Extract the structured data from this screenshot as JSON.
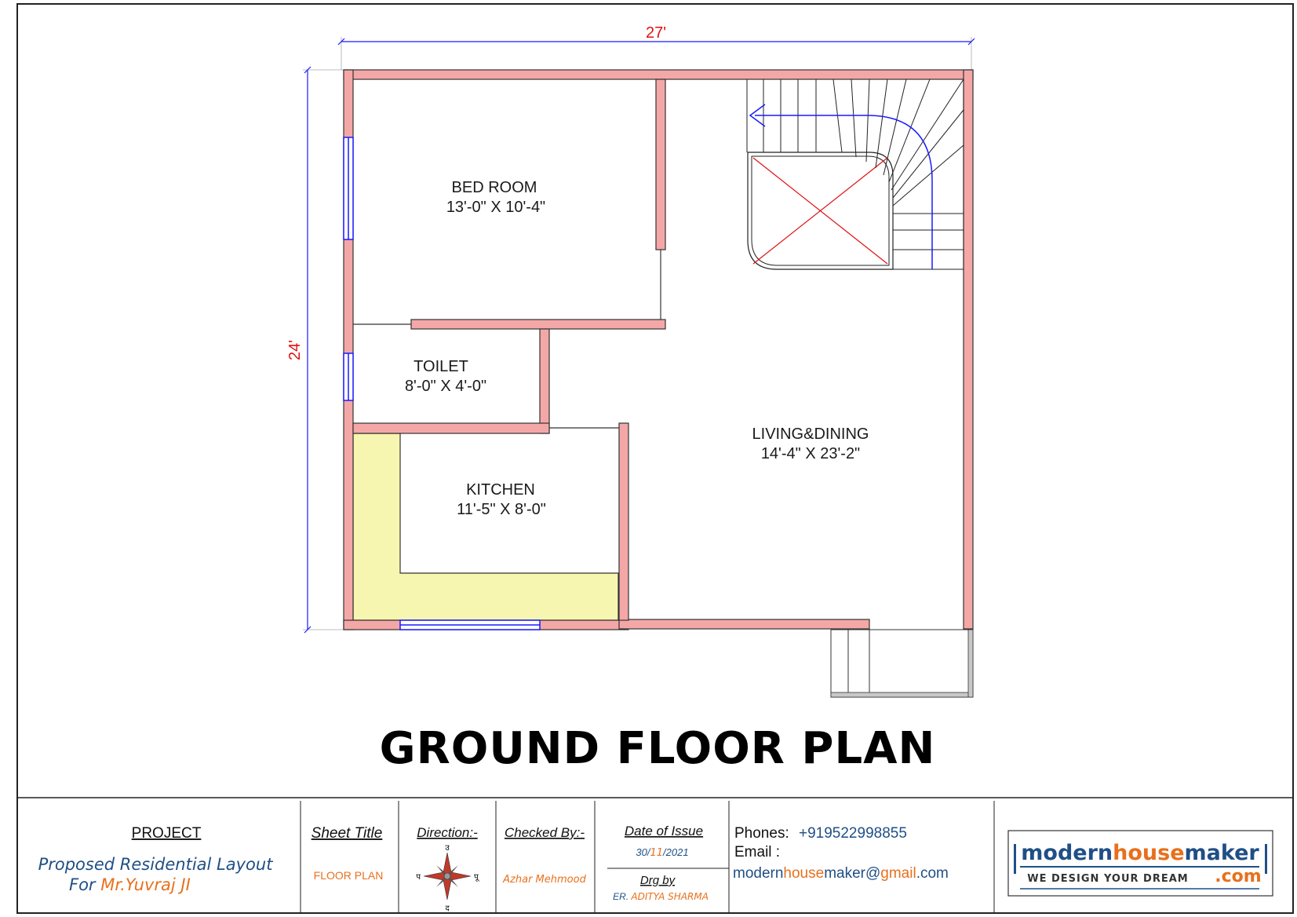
{
  "dimensions": {
    "width": "27'",
    "height": "24'"
  },
  "rooms": {
    "bedroom": {
      "name": "BED ROOM",
      "size": "13'-0\" X 10'-4\""
    },
    "toilet": {
      "name": "TOILET",
      "size": "8'-0\" X 4'-0\""
    },
    "kitchen": {
      "name": "KITCHEN",
      "size": "11'-5\" X 8'-0\""
    },
    "living": {
      "name": "LIVING&DINING",
      "size": "14'-4\" X 23'-2\""
    }
  },
  "title": "GROUND FLOOR PLAN",
  "title_block": {
    "project_label": "PROJECT",
    "project_line1": "Proposed Residential Layout",
    "project_line2_prefix": "For ",
    "project_client": "Mr.Yuvraj JI",
    "sheet_title_label": "Sheet Title",
    "sheet_title_value": "FLOOR PLAN",
    "direction_label": "Direction:-",
    "compass": {
      "n": "उ",
      "e": "पू",
      "w": "प",
      "s": "द"
    },
    "checked_label": "Checked By:-",
    "checked_value": "Azhar Mehmood",
    "date_label": "Date of Issue",
    "date_day": "30/",
    "date_month": "11",
    "date_year": "/2021",
    "drg_label": "Drg by",
    "drg_prefix": "ER. ",
    "drg_value": "ADITYA SHARMA",
    "phones_label": "Phones:",
    "phones_value": "+919522998855",
    "email_label": "Email :",
    "email_part1": "modern",
    "email_part2": "house",
    "email_part3": "maker@",
    "email_part4": "gmail",
    "email_part5": ".com"
  },
  "logo": {
    "part1": "modern",
    "part2": "house",
    "part3": "maker",
    "tagline": "WE DESIGN YOUR DREAM",
    "suffix": ".com"
  },
  "colors": {
    "wall": "#f4a7a7",
    "kitchen_counter": "#f6f6b0",
    "dimension": "#1a1aff",
    "dimension_text": "#e01010",
    "brand_blue": "#1f4f86",
    "brand_orange": "#e8701c"
  }
}
